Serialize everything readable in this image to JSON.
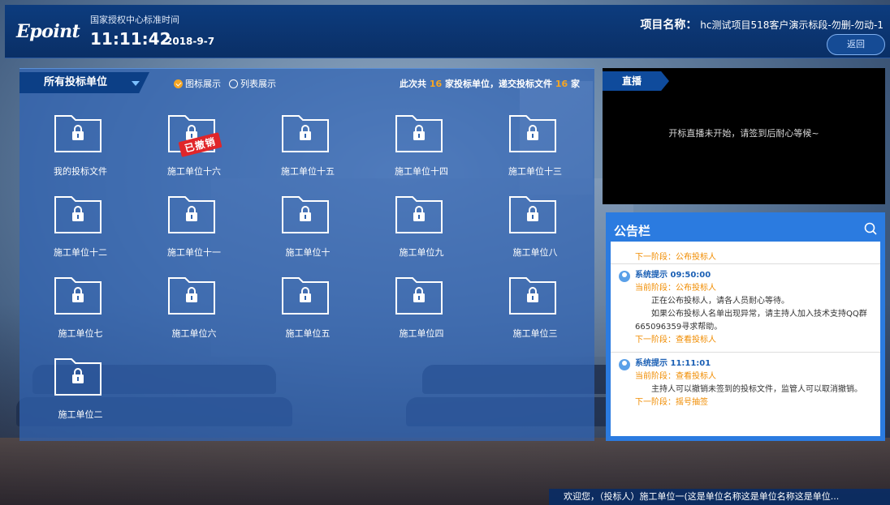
{
  "header": {
    "logo": "Epoint",
    "time_label": "国家授权中心标准时间",
    "clock": "11:11:42",
    "date": "2018-9-7",
    "project_label": "项目名称：",
    "project_name": "hc测试项目518客户演示标段-勿删-勿动-1",
    "back_label": "返回"
  },
  "panel": {
    "unit_select": "所有投标单位",
    "view_icon": "图标展示",
    "view_list": "列表展示",
    "summary_pre": "此次共",
    "summary_units": "16",
    "summary_mid": "家投标单位，递交投标文件",
    "summary_files": "16",
    "summary_post": "家",
    "revoked_label": "已撤销",
    "folders": [
      "我的投标文件",
      "施工单位十六",
      "施工单位十五",
      "施工单位十四",
      "施工单位十三",
      "施工单位十二",
      "施工单位十一",
      "施工单位十",
      "施工单位九",
      "施工单位八",
      "施工单位七",
      "施工单位六",
      "施工单位五",
      "施工单位四",
      "施工单位三",
      "施工单位二"
    ]
  },
  "live": {
    "tab": "直播",
    "message": "开标直播未开始，请签到后耐心等候~"
  },
  "bulletin": {
    "title": "公告栏",
    "top_next": "下一阶段：公布投标人",
    "items": [
      {
        "head": "系统提示 09:50:00",
        "stage": "当前阶段：公布投标人",
        "text1": "正在公布投标人，请各人员耐心等待。",
        "text2": "如果公布投标人名单出现异常，请主持人加入技术支持QQ群665096359寻求帮助。",
        "next": "下一阶段：查看投标人"
      },
      {
        "head": "系统提示 11:11:01",
        "stage": "当前阶段：查看投标人",
        "text1": "主持人可以撤销未签到的投标文件，监管人可以取消撤销。",
        "next": "下一阶段：摇号抽签"
      }
    ]
  },
  "ticker": {
    "text": "欢迎您，（投标人）施工单位一(这是单位名称这是单位名称这是单位..."
  },
  "colors": {
    "accent": "#f6a623",
    "header_bg": "#0d3c7e",
    "bulletin_bg": "#2b7be0",
    "revoked": "#e0262a"
  }
}
